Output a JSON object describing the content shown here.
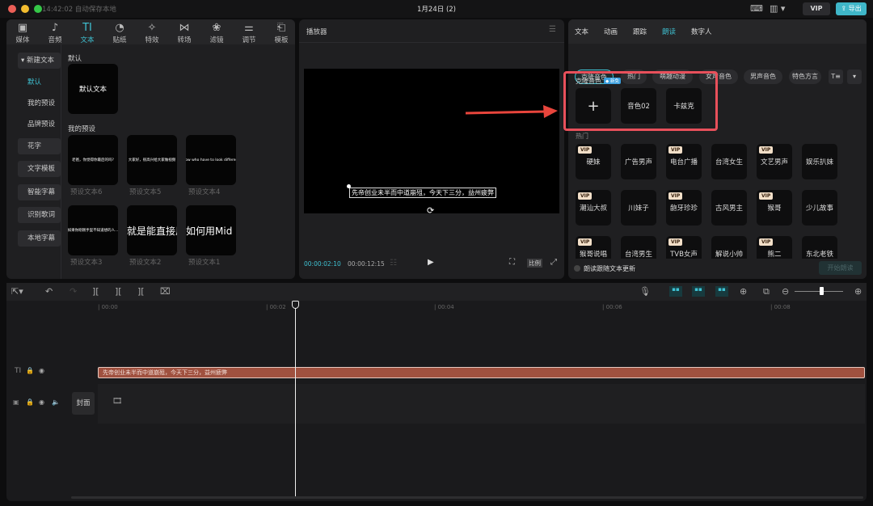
{
  "window": {
    "time_status": "14:42:02 自动保存本地",
    "title": "1月24日 (2)",
    "vip": "VIP",
    "export": "导出"
  },
  "toolbar": [
    {
      "icon": "media-icon",
      "glyph": "▣",
      "label": "媒体"
    },
    {
      "icon": "audio-icon",
      "glyph": "♪",
      "label": "音频"
    },
    {
      "icon": "text-icon",
      "glyph": "TI",
      "label": "文本"
    },
    {
      "icon": "sticker-icon",
      "glyph": "◔",
      "label": "贴纸"
    },
    {
      "icon": "effects-icon",
      "glyph": "✧",
      "label": "特效"
    },
    {
      "icon": "transition-icon",
      "glyph": "⋈",
      "label": "转场"
    },
    {
      "icon": "filter-icon",
      "glyph": "❀",
      "label": "滤镜"
    },
    {
      "icon": "adjust-icon",
      "glyph": "⚌",
      "label": "调节"
    },
    {
      "icon": "template-icon",
      "glyph": "⎗",
      "label": "模板"
    }
  ],
  "sidebar": [
    {
      "label": "▾ 新建文本",
      "box": true
    },
    {
      "label": "默认",
      "selected": true
    },
    {
      "label": "我的预设"
    },
    {
      "label": "品牌预设"
    },
    {
      "label": "花字",
      "box": true
    },
    {
      "label": "文字模板",
      "box": true
    },
    {
      "label": "智能字幕",
      "box": true
    },
    {
      "label": "识别歌词",
      "box": true
    },
    {
      "label": "本地字幕",
      "box": true
    }
  ],
  "library": {
    "default_heading": "默认",
    "default_item": "默认文本",
    "presets_heading": "我的预设",
    "presets": [
      {
        "preview": "老爸，你觉得你最后的吗?",
        "label": "预设文本6"
      },
      {
        "preview": "大家好，很高兴给大家做视频",
        "label": "预设文本5"
      },
      {
        "preview": "I I know who have to look differently...",
        "label": "预设文本4"
      },
      {
        "preview": "如果你刚刚手里不知道想的人...",
        "label": "预设文本3"
      },
      {
        "preview": "就是能直接用",
        "label": "预设文本2",
        "big": true
      },
      {
        "preview": "如何用Mid",
        "label": "预设文本1",
        "big": true
      }
    ]
  },
  "player": {
    "title": "播放器",
    "subtitle": "先帝创业未半而中道崩殂，今天下三分，益州疲弊",
    "current_time": "00:00:02:10",
    "total_time": "00:00:12:15",
    "ratio": "比例"
  },
  "right": {
    "tabs": [
      "文本",
      "动画",
      "跟踪",
      "朗读",
      "数字人"
    ],
    "active_tab": "朗读",
    "chips": [
      "克隆音色",
      "热门",
      "萌趣动漫",
      "女声音色",
      "男声音色",
      "特色方言"
    ],
    "clone_heading": "克隆音色",
    "new_badge": "◆ 新免",
    "clone_voices": [
      "+",
      "音色02",
      "卡兹克"
    ],
    "hot_heading": "热门",
    "voices": [
      {
        "name": "硬妹",
        "vip": true
      },
      {
        "name": "广告男声"
      },
      {
        "name": "电台广播",
        "vip": true
      },
      {
        "name": "台湾女生"
      },
      {
        "name": "文艺男声",
        "vip": true
      },
      {
        "name": "娱乐扒妹"
      },
      {
        "name": "潮汕大叔",
        "vip": true
      },
      {
        "name": "川妹子"
      },
      {
        "name": "龅牙珍珍",
        "vip": true
      },
      {
        "name": "古风男主"
      },
      {
        "name": "猴哥",
        "vip": true
      },
      {
        "name": "少儿故事"
      },
      {
        "name": "猴哥说唱",
        "vip": true
      },
      {
        "name": "台湾男生"
      },
      {
        "name": "TVB女声",
        "vip": true
      },
      {
        "name": "解说小帅"
      },
      {
        "name": "熊二",
        "vip": true
      },
      {
        "name": "东北老铁"
      }
    ],
    "vip_label": "VIP",
    "follow_text": "朗读跟随文本更新",
    "start_button": "开始朗读"
  },
  "timeline": {
    "ruler": [
      "00:00",
      "00:02",
      "00:04",
      "00:06",
      "00:08"
    ],
    "clip_text": "先帝创业未半而中道崩殂，今天下三分，益州疲弊",
    "cover": "封面",
    "zoom_level": 0.55
  },
  "colors": {
    "accent": "#3fc2d3",
    "clip": "#a0513f",
    "highlight": "#e8505b"
  }
}
